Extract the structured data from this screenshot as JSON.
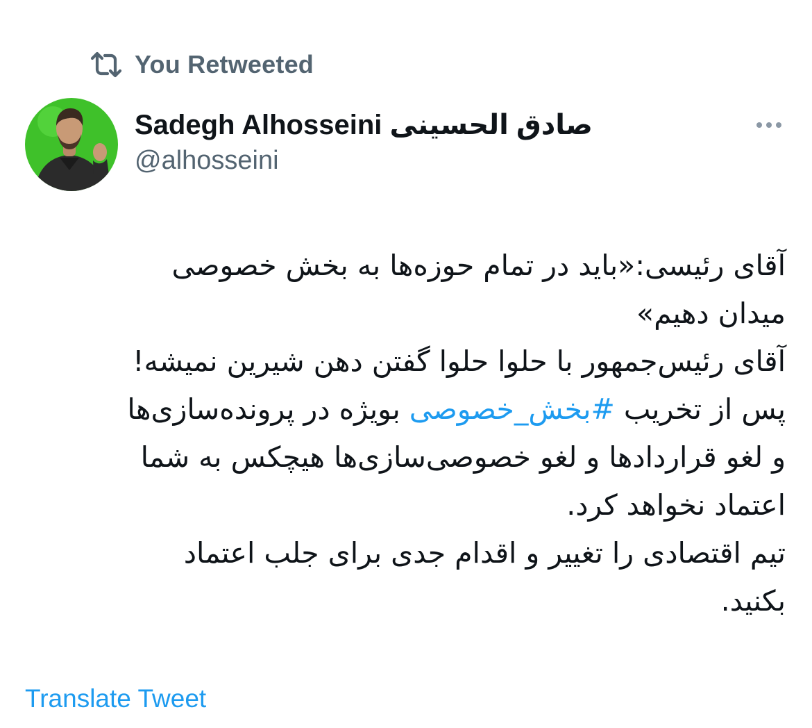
{
  "retweet_banner": {
    "icon": "retweet-icon",
    "label": "You Retweeted"
  },
  "author": {
    "avatar": "profile-photo",
    "display_name": "Sadegh Alhosseini صادق الحسینی",
    "handle": "@alhosseini"
  },
  "more_menu": {
    "icon": "more-horizontal-icon"
  },
  "tweet": {
    "lines": [
      "آقای رئیسی:«باید در تمام حوزه‌ها به بخش خصوصی",
      "میدان دهیم»",
      "آقای رئیس‌جمهور با حلوا حلوا گفتن دهن شیرین نمیشه!",
      {
        "before": "پس از تخریب ",
        "hashtag": "#بخش_خصوصی",
        "after": " بویژه در پرونده‌سازی‌ها"
      },
      "و لغو قراردادها و لغو خصوصی‌سازی‌ها هیچکس به شما",
      "اعتماد نخواهد کرد.",
      "تیم اقتصادی را تغییر و اقدام جدی برای جلب اعتماد",
      "بکنید."
    ]
  },
  "translate_label": "Translate Tweet",
  "colors": {
    "text_primary": "#0f1419",
    "text_secondary": "#536471",
    "link_blue": "#1d9bf0"
  }
}
